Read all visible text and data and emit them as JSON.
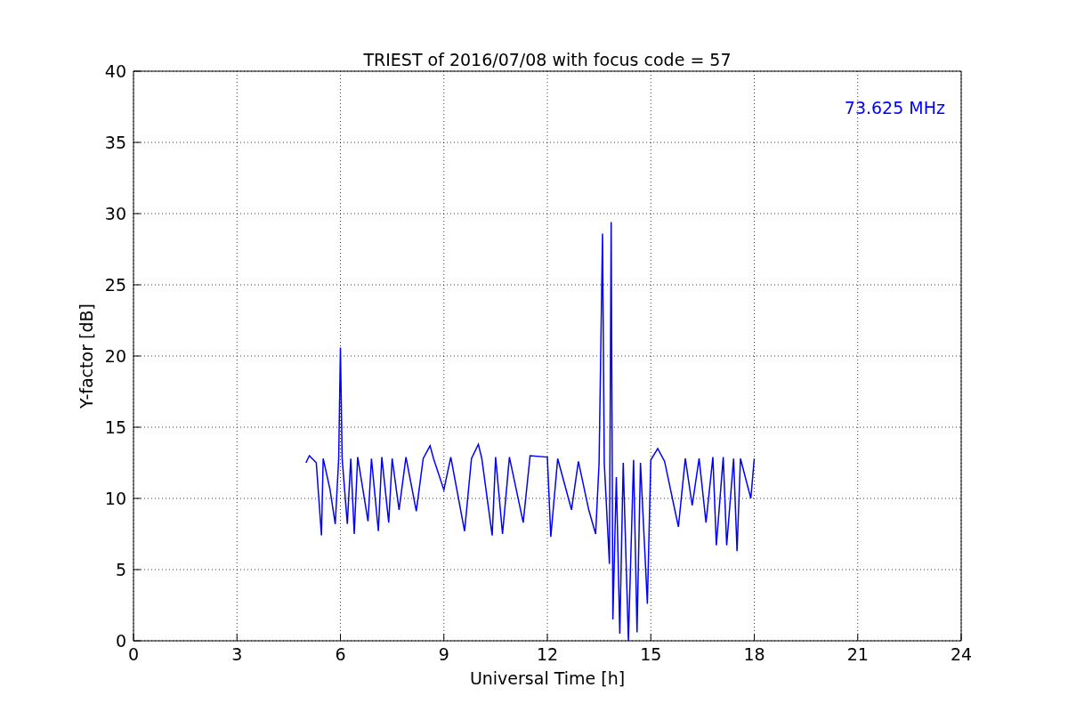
{
  "chart_data": {
    "type": "line",
    "title": "TRIEST of 2016/07/08 with focus code = 57",
    "xlabel": "Universal Time [h]",
    "ylabel": "Y-factor [dB]",
    "xlim": [
      0,
      24
    ],
    "ylim": [
      0,
      40
    ],
    "xticks": [
      0,
      3,
      6,
      9,
      12,
      15,
      18,
      21,
      24
    ],
    "yticks": [
      0,
      5,
      10,
      15,
      20,
      25,
      30,
      35,
      40
    ],
    "x": [
      5.0,
      5.1,
      5.3,
      5.45,
      5.5,
      5.7,
      5.85,
      5.95,
      6.0,
      6.05,
      6.2,
      6.3,
      6.4,
      6.5,
      6.8,
      6.9,
      7.1,
      7.2,
      7.4,
      7.5,
      7.7,
      7.9,
      8.2,
      8.4,
      8.6,
      8.7,
      9.0,
      9.2,
      9.6,
      9.8,
      10.0,
      10.1,
      10.4,
      10.5,
      10.7,
      10.9,
      11.3,
      11.5,
      12.0,
      12.1,
      12.3,
      12.7,
      12.9,
      13.2,
      13.4,
      13.5,
      13.6,
      13.65,
      13.8,
      13.85,
      13.9,
      14.0,
      14.1,
      14.2,
      14.35,
      14.5,
      14.6,
      14.7,
      14.9,
      15.0,
      15.2,
      15.4,
      15.8,
      16.0,
      16.2,
      16.4,
      16.6,
      16.8,
      16.9,
      17.1,
      17.2,
      17.4,
      17.5,
      17.6,
      17.9,
      18.0
    ],
    "series": [
      {
        "name": "73.625 MHz",
        "color": "#0000ff",
        "values": [
          12.5,
          13,
          12.5,
          7.4,
          12.8,
          10.6,
          8.2,
          12.8,
          20.6,
          12.8,
          8.2,
          12.8,
          7.5,
          12.9,
          8.4,
          12.8,
          7.7,
          12.9,
          8.3,
          12.8,
          9.2,
          12.9,
          9.1,
          12.8,
          13.7,
          12.8,
          10.6,
          12.9,
          7.7,
          12.8,
          13.8,
          12.8,
          7.4,
          12.9,
          7.5,
          12.9,
          8.3,
          13.0,
          12.9,
          7.3,
          12.8,
          9.2,
          12.6,
          9.2,
          7.5,
          12.5,
          28.6,
          12.5,
          5.4,
          29.4,
          1.5,
          11.5,
          0.5,
          12.5,
          0,
          12.7,
          0.6,
          12.5,
          2.6,
          12.7,
          13.5,
          12.6,
          8.0,
          12.8,
          9.5,
          12.8,
          8.3,
          12.9,
          6.7,
          12.9,
          6.7,
          12.8,
          6.3,
          12.8,
          10,
          12.8
        ]
      }
    ],
    "grid": true
  }
}
